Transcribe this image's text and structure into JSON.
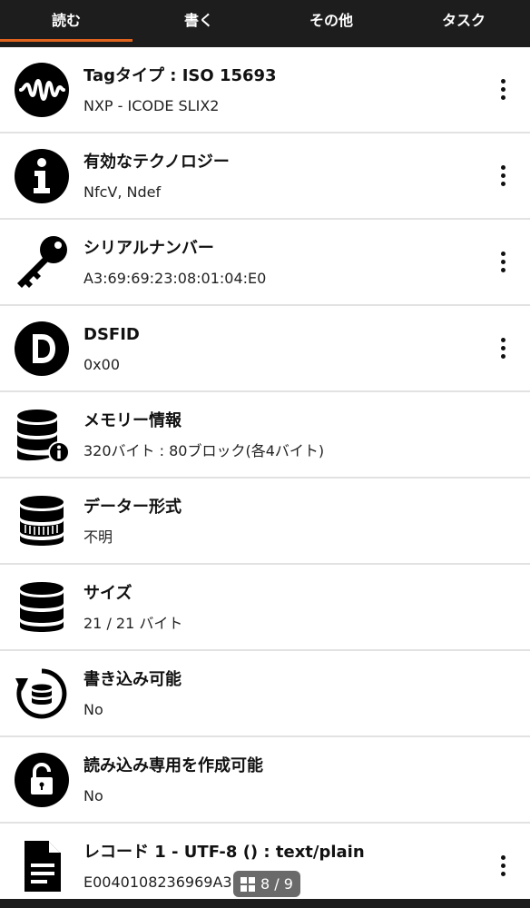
{
  "tabs": [
    {
      "label": "読む",
      "active": true
    },
    {
      "label": "書く",
      "active": false
    },
    {
      "label": "その他",
      "active": false
    },
    {
      "label": "タスク",
      "active": false
    }
  ],
  "accent_color": "#e0631d",
  "rows": [
    {
      "icon": "waveform-icon",
      "title": "Tagタイプ : ISO 15693",
      "subtitle": "NXP - ICODE SLIX2",
      "has_menu": true
    },
    {
      "icon": "info-icon",
      "title": "有効なテクノロジー",
      "subtitle": "NfcV, Ndef",
      "has_menu": true
    },
    {
      "icon": "key-icon",
      "title": "シリアルナンバー",
      "subtitle": "A3:69:69:23:08:01:04:E0",
      "has_menu": true
    },
    {
      "icon": "dsfid-icon",
      "title": "DSFID",
      "subtitle": "0x00",
      "has_menu": true
    },
    {
      "icon": "database-info-icon",
      "title": "メモリー情報",
      "subtitle": "320バイト : 80ブロック(各4バイト)",
      "has_menu": false
    },
    {
      "icon": "database-format-icon",
      "title": "データー形式",
      "subtitle": "不明",
      "has_menu": false
    },
    {
      "icon": "database-icon",
      "title": "サイズ",
      "subtitle": "21 / 21 バイト",
      "has_menu": false
    },
    {
      "icon": "database-refresh-icon",
      "title": "書き込み可能",
      "subtitle": "No",
      "has_menu": false
    },
    {
      "icon": "lock-icon",
      "title": "読み込み専用を作成可能",
      "subtitle": "No",
      "has_menu": false
    },
    {
      "icon": "document-icon",
      "title": "レコード 1 - UTF-8 () : text/plain",
      "subtitle": "E0040108236969A3",
      "has_menu": true
    }
  ],
  "page_indicator": "8 / 9"
}
